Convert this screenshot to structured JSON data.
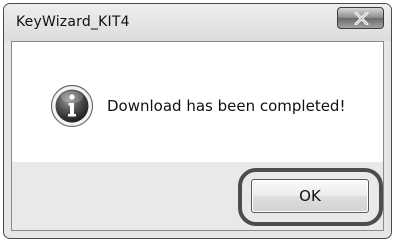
{
  "window": {
    "title": "KeyWizard_KIT4"
  },
  "dialog": {
    "message": "Download has been completed!",
    "icon": "info-icon",
    "ok_label": "OK"
  },
  "title_bar": {
    "close_icon": "close-icon"
  }
}
